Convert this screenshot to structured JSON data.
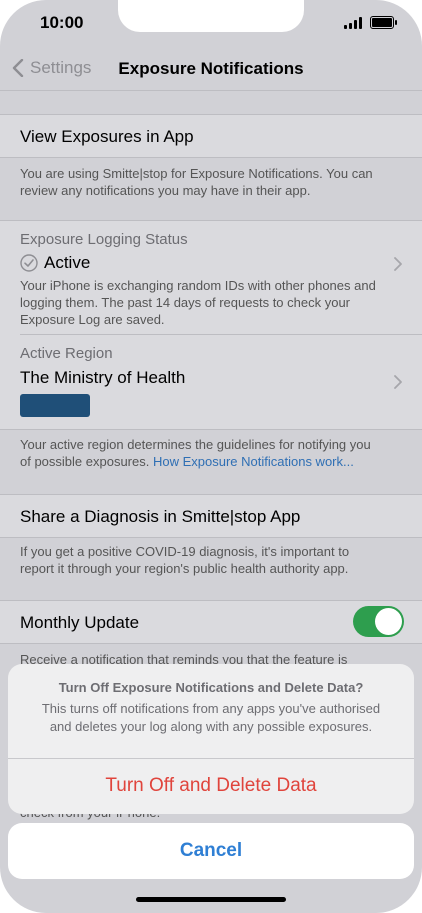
{
  "status": {
    "time": "10:00"
  },
  "nav": {
    "back_label": "Settings",
    "title": "Exposure Notifications"
  },
  "view_exposures": {
    "label": "View Exposures in App",
    "note": "You are using Smitte|stop for Exposure Notifications. You can review any notifications you may have in their app."
  },
  "logging": {
    "header": "Exposure Logging Status",
    "status": "Active",
    "note": "Your iPhone is exchanging random IDs with other phones and logging them. The past 14 days of requests to check your Exposure Log are saved."
  },
  "region": {
    "header": "Active Region",
    "name": "The Ministry of Health",
    "note": "Your active region determines the guidelines for notifying you of possible exposures.",
    "link": "How Exposure Notifications work..."
  },
  "share": {
    "label": "Share a Diagnosis in Smitte|stop App",
    "note": "If you get a positive COVID-19 diagnosis, it's important to report it through your region's public health authority app."
  },
  "monthly": {
    "label": "Monthly Update",
    "enabled": true,
    "note": "Receive a notification that reminds you that the feature is",
    "note_tail": "check from your iPhone."
  },
  "sheet": {
    "title": "Turn Off Exposure Notifications and Delete Data?",
    "message": "This turns off notifications from any apps you've authorised and deletes your log along with any possible exposures.",
    "destructive_label": "Turn Off and Delete Data",
    "cancel_label": "Cancel"
  },
  "colors": {
    "link": "#2f6fb4",
    "destructive": "#e0443c",
    "toggle_on": "#2e9e4e",
    "cancel": "#2f7fd4"
  }
}
